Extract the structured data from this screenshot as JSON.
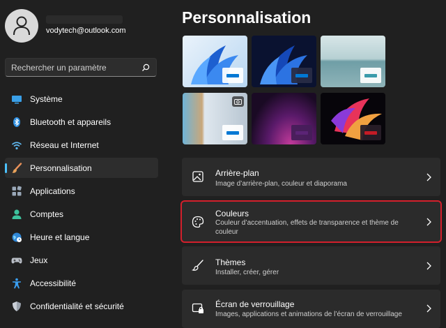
{
  "user": {
    "name": "",
    "email": "vodytech@outlook.com"
  },
  "search": {
    "placeholder": "Rechercher un paramètre"
  },
  "sidebar": {
    "items": [
      {
        "label": "Système",
        "icon": "system-icon"
      },
      {
        "label": "Bluetooth et appareils",
        "icon": "bluetooth-icon"
      },
      {
        "label": "Réseau et Internet",
        "icon": "wifi-icon"
      },
      {
        "label": "Personnalisation",
        "icon": "brush-icon",
        "active": true
      },
      {
        "label": "Applications",
        "icon": "apps-icon"
      },
      {
        "label": "Comptes",
        "icon": "account-icon"
      },
      {
        "label": "Heure et langue",
        "icon": "globe-icon"
      },
      {
        "label": "Jeux",
        "icon": "gamepad-icon"
      },
      {
        "label": "Accessibilité",
        "icon": "accessibility-icon"
      },
      {
        "label": "Confidentialité et sécurité",
        "icon": "shield-icon"
      }
    ]
  },
  "main": {
    "title": "Personnalisation",
    "themes": [
      {
        "name": "theme-windows-light",
        "chip_color": "#0078d4"
      },
      {
        "name": "theme-windows-dark",
        "chip_color": "#0078d4"
      },
      {
        "name": "theme-glow",
        "chip_color": "#3a9bab"
      },
      {
        "name": "theme-captured-motion",
        "chip_color": "#0078d4"
      },
      {
        "name": "theme-sunrise",
        "chip_color": "#5b2476"
      },
      {
        "name": "theme-flow",
        "chip_color": "#c41b26"
      }
    ],
    "cards": [
      {
        "title": "Arrière-plan",
        "description": "Image d’arrière-plan, couleur et diaporama",
        "icon": "picture-icon"
      },
      {
        "title": "Couleurs",
        "description": "Couleur d’accentuation, effets de transparence et thème de couleur",
        "icon": "palette-icon",
        "highlighted": true
      },
      {
        "title": "Thèmes",
        "description": "Installer, créer, gérer",
        "icon": "brush-icon"
      },
      {
        "title": "Écran de verrouillage",
        "description": "Images, applications et animations de l’écran de verrouillage",
        "icon": "lock-screen-icon"
      }
    ]
  },
  "colors": {
    "accent": "#4cc2ff",
    "highlight_border": "#d4202c",
    "background": "#202020",
    "card": "#2b2b2b"
  }
}
